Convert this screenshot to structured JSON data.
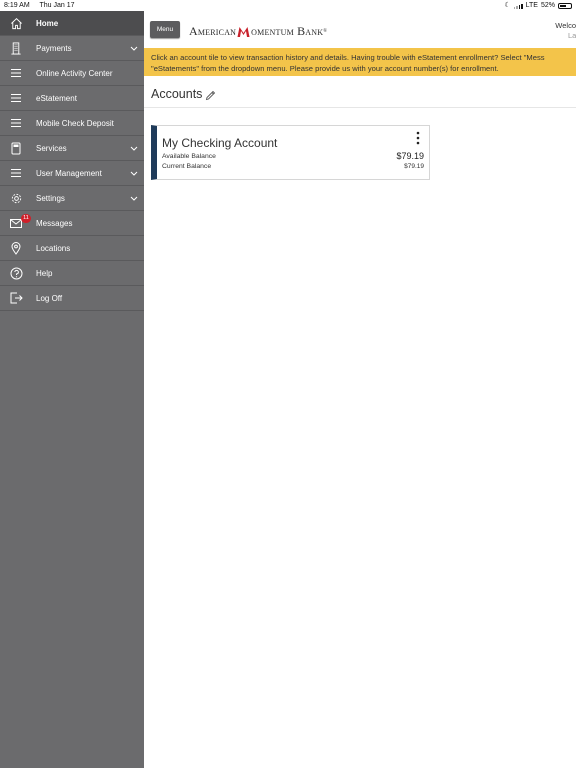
{
  "status_bar": {
    "time": "8:19 AM",
    "date": "Thu Jan 17",
    "network": "LTE",
    "battery": "52%"
  },
  "sidebar": {
    "items": [
      {
        "label": "Home",
        "icon": "home-icon",
        "active": true
      },
      {
        "label": "Payments",
        "icon": "building-icon",
        "has_submenu": true
      },
      {
        "label": "Online Activity Center",
        "icon": "hamburger-icon"
      },
      {
        "label": "eStatement",
        "icon": "hamburger-icon"
      },
      {
        "label": "Mobile Check Deposit",
        "icon": "hamburger-icon"
      },
      {
        "label": "Services",
        "icon": "calculator-icon",
        "has_submenu": true
      },
      {
        "label": "User Management",
        "icon": "hamburger-icon",
        "has_submenu": true
      },
      {
        "label": "Settings",
        "icon": "gear-icon",
        "has_submenu": true
      },
      {
        "label": "Messages",
        "icon": "envelope-icon",
        "badge": "11"
      },
      {
        "label": "Locations",
        "icon": "map-pin-icon"
      },
      {
        "label": "Help",
        "icon": "question-icon"
      },
      {
        "label": "Log Off",
        "icon": "logout-icon"
      }
    ]
  },
  "header": {
    "menu_label": "Menu",
    "logo_part1": "American",
    "logo_part2": "omentum Bank",
    "logo_mark": "®",
    "welcome": "Welco",
    "welcome_sub": "La"
  },
  "banner": {
    "line1": "Click an account tile to view transaction history and details. Having trouble with eStatement enrollment? Select \"Mess",
    "line2": "\"eStatements\" from the dropdown menu. Please provide us with your account number(s) for enrollment."
  },
  "accounts": {
    "title": "Accounts",
    "tiles": [
      {
        "name": "My Checking Account",
        "available_label": "Available Balance",
        "available_value": "$79.19",
        "current_label": "Current Balance",
        "current_value": "$79.19"
      }
    ]
  },
  "colors": {
    "sidebar_bg": "#6b6b6d",
    "sidebar_active": "#4d4d4f",
    "banner_bg": "#f3c44a",
    "tile_accent": "#1f3b5a",
    "badge_red": "#d0202a",
    "logo_red": "#c8202b"
  }
}
